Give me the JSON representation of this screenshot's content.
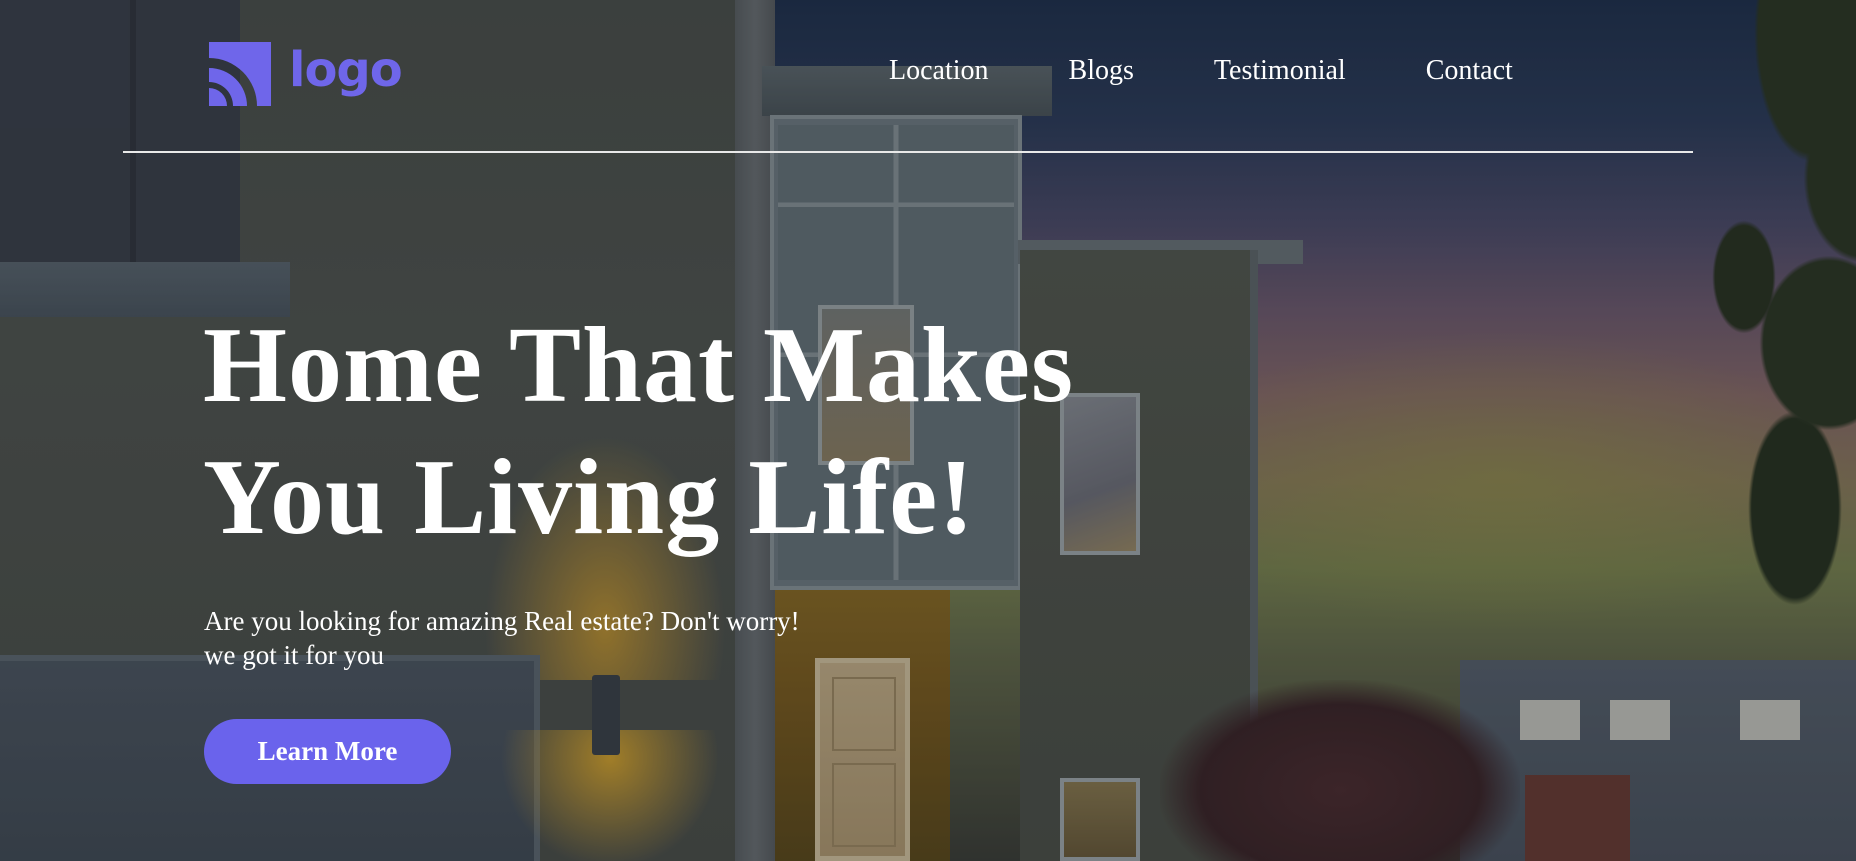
{
  "header": {
    "logo_text": "logo",
    "logo_icon": "wifi-arc-icon",
    "nav": [
      {
        "label": "Location"
      },
      {
        "label": "Blogs"
      },
      {
        "label": "Testimonial"
      },
      {
        "label": "Contact"
      }
    ]
  },
  "hero": {
    "title_line1": "Home That Makes",
    "title_line2": "You Living Life!",
    "subtitle_line1": "Are you looking for amazing Real estate? Don't worry!",
    "subtitle_line2": "we got it for you",
    "cta_label": "Learn More"
  },
  "colors": {
    "brand": "#6a63ec",
    "text": "#ffffff",
    "divider": "#e9e9e9"
  }
}
